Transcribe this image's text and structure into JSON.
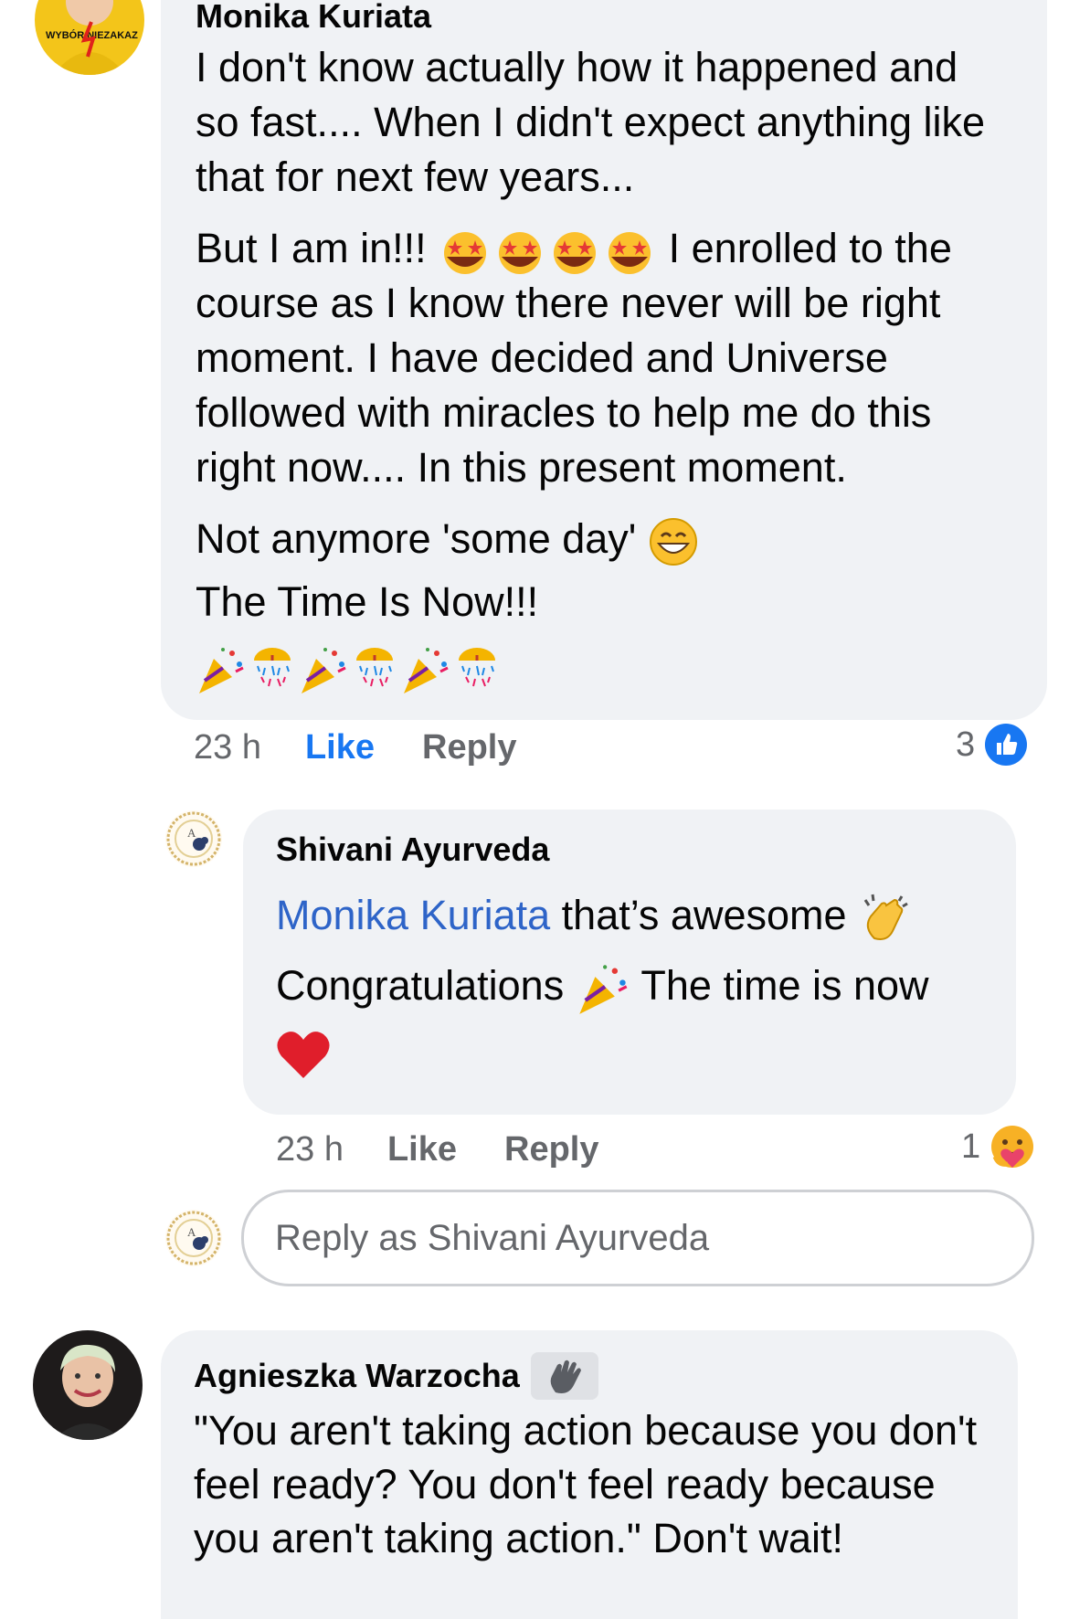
{
  "comments": [
    {
      "author": "Monika Kuriata",
      "avatar_text": "WYBÓR NIEZAKAZ",
      "lines_p1": "I don't know actually how it happened and so fast.... When I didn't expect anything like that for next few years...",
      "p2_start": "But I am in!!!",
      "p2_end": "I enrolled to the course as I know there never will be right moment. I have decided and Universe followed with miracles to help me do this right now.... In this present moment.",
      "p3": "Not anymore 'some day'",
      "p4": "The Time Is Now!!!",
      "time": "23 h",
      "like_label": "Like",
      "reply_label": "Reply",
      "reaction_count": "3"
    },
    {
      "author": "Shivani Ayurveda",
      "mention": "Monika Kuriata",
      "line1_rest": "that’s awesome",
      "line2_start": "Congratulations",
      "line2_end": "The time is now",
      "time": "23 h",
      "like_label": "Like",
      "reply_label": "Reply",
      "reaction_count": "1"
    },
    {
      "author": "Agnieszka Warzocha",
      "text": "\"You aren't taking action  because you don't feel ready? You don't feel ready because you aren't taking action.\" Don't wait!"
    }
  ],
  "reply_box": {
    "placeholder": "Reply as Shivani Ayurveda"
  },
  "icons": {
    "like": "like-thumb-icon",
    "care": "care-reaction-icon",
    "star_struck": "star-struck-emoji-icon",
    "grin": "grinning-emoji-icon",
    "party_popper": "party-popper-emoji-icon",
    "confetti_ball": "confetti-ball-emoji-icon",
    "clap": "clapping-hands-emoji-icon",
    "heart": "red-heart-emoji-icon",
    "wave": "waving-hand-badge-icon"
  },
  "colors": {
    "bubble": "#f0f2f5",
    "link": "#1877f2",
    "mention": "#2e64c8",
    "meta": "#65676b"
  }
}
